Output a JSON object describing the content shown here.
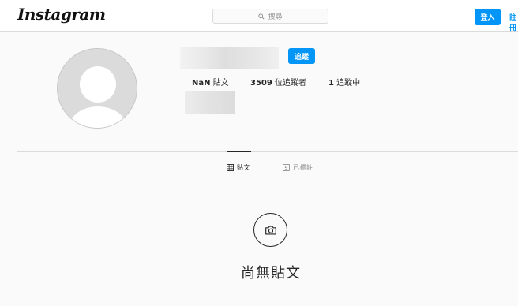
{
  "header": {
    "logo": "Instagram",
    "search_placeholder": "搜尋",
    "login_label": "登入",
    "signup_label": "註冊"
  },
  "profile": {
    "follow_label": "追蹤",
    "stats": {
      "posts_count": "NaN",
      "posts_label": "貼文",
      "followers_count": "3509",
      "followers_label": "位追蹤者",
      "following_count": "1",
      "following_label": "追蹤中"
    }
  },
  "tabs": [
    {
      "label": "貼文",
      "icon": "grid-icon",
      "active": true
    },
    {
      "label": "已標註",
      "icon": "tag-icon",
      "active": false
    }
  ],
  "empty_state": {
    "icon": "camera-icon",
    "text": "尚無貼文"
  },
  "colors": {
    "accent": "#0095f6",
    "background": "#fafafa",
    "text": "#262626",
    "muted": "#8e8e8e"
  }
}
